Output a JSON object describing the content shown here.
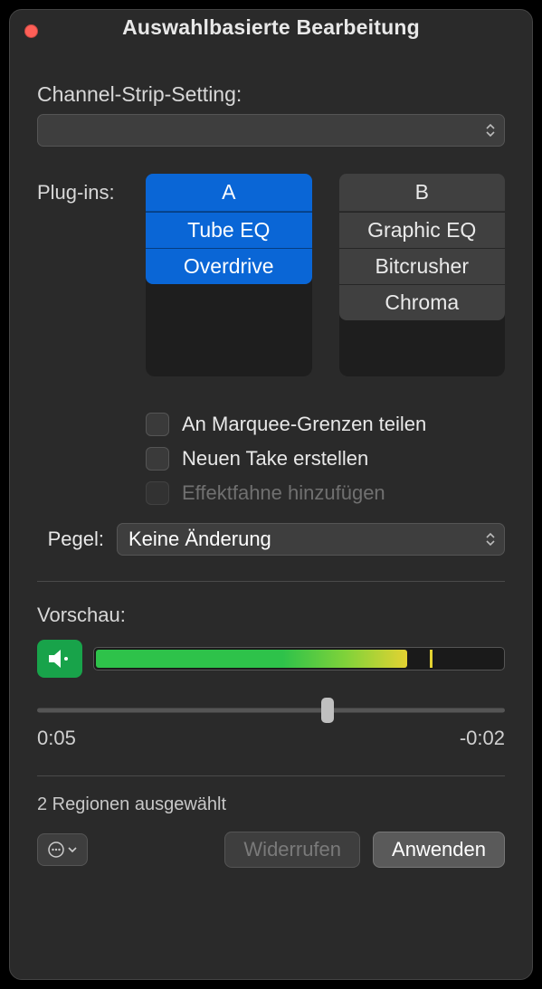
{
  "window": {
    "title": "Auswahlbasierte Bearbeitung"
  },
  "channel_strip": {
    "label": "Channel-Strip-Setting:",
    "value": ""
  },
  "plugins": {
    "label": "Plug-ins:",
    "col_a": {
      "header": "A",
      "items": [
        "Tube EQ",
        "Overdrive"
      ]
    },
    "col_b": {
      "header": "B",
      "items": [
        "Graphic EQ",
        "Bitcrusher",
        "Chroma"
      ]
    }
  },
  "checks": {
    "marquee": "An Marquee-Grenzen teilen",
    "new_take": "Neuen Take erstellen",
    "effect_flag": "Effektfahne hinzufügen"
  },
  "pegel": {
    "label": "Pegel:",
    "value": "Keine Änderung"
  },
  "preview": {
    "label": "Vorschau:",
    "meter_fill_pct": 76,
    "meter_peak_pct": 82,
    "slider_pct": 62,
    "time_start": "0:05",
    "time_end": "-0:02"
  },
  "status": "2 Regionen ausgewählt",
  "footer": {
    "undo": "Widerrufen",
    "apply": "Anwenden"
  }
}
